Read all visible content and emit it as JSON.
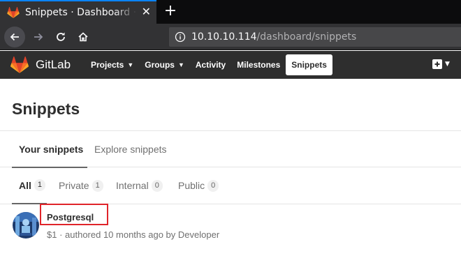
{
  "browser": {
    "tab_title": "Snippets · Dashboard · GitLab",
    "url_host": "10.10.10.114",
    "url_path": "/dashboard/snippets"
  },
  "header": {
    "brand": "GitLab",
    "nav": [
      {
        "label": "Projects",
        "dropdown": true
      },
      {
        "label": "Groups",
        "dropdown": true
      },
      {
        "label": "Activity",
        "dropdown": false
      },
      {
        "label": "Milestones",
        "dropdown": false
      },
      {
        "label": "Snippets",
        "dropdown": false,
        "active": true
      }
    ]
  },
  "page": {
    "title": "Snippets",
    "primary_tabs": [
      {
        "label": "Your snippets",
        "active": true
      },
      {
        "label": "Explore snippets",
        "active": false
      }
    ],
    "filter_tabs": [
      {
        "label": "All",
        "count": "1",
        "active": true
      },
      {
        "label": "Private",
        "count": "1"
      },
      {
        "label": "Internal",
        "count": "0"
      },
      {
        "label": "Public",
        "count": "0"
      }
    ],
    "snippet": {
      "title": "Postgresql",
      "meta": "$1 · authored 10 months ago by Developer"
    }
  },
  "colors": {
    "header_bg": "#2e2e2e",
    "highlight_box": "#e0242a",
    "browser_accent": "#0a84ff"
  }
}
